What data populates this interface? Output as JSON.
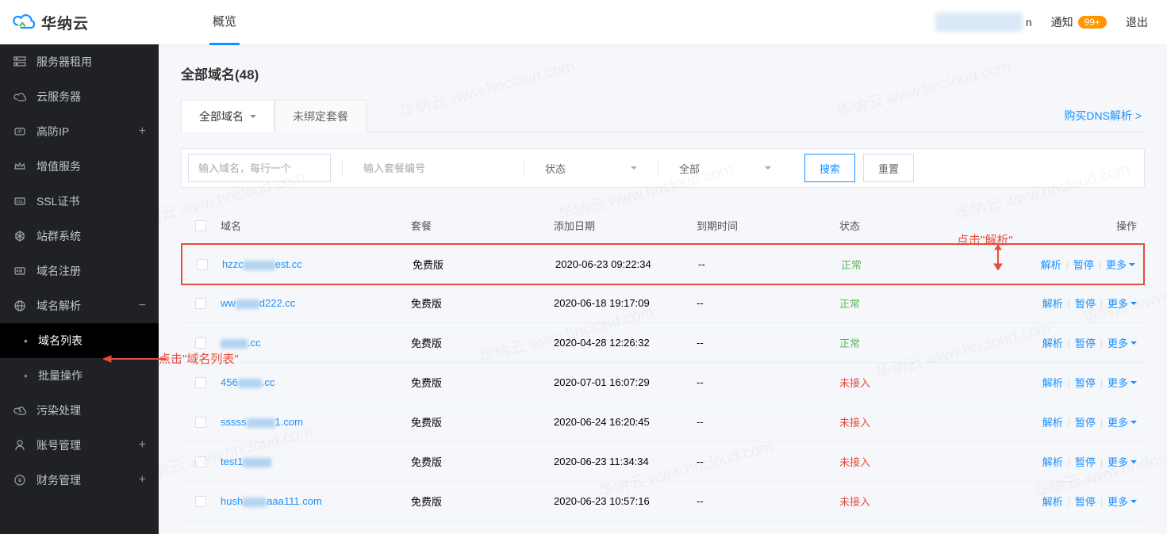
{
  "brand": "华纳云",
  "topnav": {
    "overview": "概览"
  },
  "user": {
    "suffix": "n"
  },
  "notification": {
    "label": "通知",
    "badge": "99+"
  },
  "logout": "退出",
  "sidebar": {
    "items": [
      {
        "label": "服务器租用",
        "icon": "server",
        "toggle": ""
      },
      {
        "label": "云服务器",
        "icon": "cloud",
        "toggle": ""
      },
      {
        "label": "高防IP",
        "icon": "shield-ip",
        "toggle": "+"
      },
      {
        "label": "增值服务",
        "icon": "crown",
        "toggle": ""
      },
      {
        "label": "SSL证书",
        "icon": "ssl",
        "toggle": ""
      },
      {
        "label": "站群系统",
        "icon": "cluster",
        "toggle": ""
      },
      {
        "label": "域名注册",
        "icon": "domain-reg",
        "toggle": ""
      },
      {
        "label": "域名解析",
        "icon": "globe",
        "toggle": "−"
      },
      {
        "label": "污染处理",
        "icon": "cloud-x",
        "toggle": ""
      },
      {
        "label": "账号管理",
        "icon": "user",
        "toggle": "+"
      },
      {
        "label": "财务管理",
        "icon": "wallet",
        "toggle": "+"
      }
    ],
    "sub": {
      "list": "域名列表",
      "batch": "批量操作"
    }
  },
  "page_title": "全部域名(48)",
  "tabs": {
    "all": "全部域名",
    "unbound": "未绑定套餐"
  },
  "buy_dns_link": "购买DNS解析 >",
  "filters": {
    "domain_placeholder": "输入域名，每行一个",
    "plan_placeholder": "输入套餐编号",
    "status_label": "状态",
    "scope_label": "全部",
    "search": "搜索",
    "reset": "重置"
  },
  "columns": {
    "domain": "域名",
    "plan": "套餐",
    "add_date": "添加日期",
    "expire": "到期时间",
    "status": "状态",
    "actions": "操作"
  },
  "status_text": {
    "ok": "正常",
    "bad": "未接入"
  },
  "action_labels": {
    "resolve": "解析",
    "pause": "暂停",
    "more": "更多"
  },
  "rows": [
    {
      "domain_pre": "hzzc",
      "domain_suf": "est.cc",
      "blur_w": 40,
      "plan": "免费版",
      "date": "2020-06-23 09:22:34",
      "expire": "--",
      "status": "ok"
    },
    {
      "domain_pre": "ww",
      "domain_suf": "d222.cc",
      "blur_w": 30,
      "plan": "免费版",
      "date": "2020-06-18 19:17:09",
      "expire": "--",
      "status": "ok"
    },
    {
      "domain_pre": "",
      "domain_suf": ".cc",
      "blur_w": 34,
      "plan": "免费版",
      "date": "2020-04-28 12:26:32",
      "expire": "--",
      "status": "ok"
    },
    {
      "domain_pre": "456",
      "domain_suf": ".cc",
      "blur_w": 30,
      "plan": "免费版",
      "date": "2020-07-01 16:07:29",
      "expire": "--",
      "status": "bad"
    },
    {
      "domain_pre": "sssss",
      "domain_suf": "1.com",
      "blur_w": 36,
      "plan": "免费版",
      "date": "2020-06-24 16:20:45",
      "expire": "--",
      "status": "bad"
    },
    {
      "domain_pre": "test1",
      "domain_suf": "",
      "blur_w": 36,
      "plan": "免费版",
      "date": "2020-06-23 11:34:34",
      "expire": "--",
      "status": "bad"
    },
    {
      "domain_pre": "hush",
      "domain_suf": "aaa111.com",
      "blur_w": 30,
      "plan": "免费版",
      "date": "2020-06-23 10:57:16",
      "expire": "--",
      "status": "bad"
    }
  ],
  "annotations": {
    "sidebar_hint": "点击\"域名列表\"",
    "action_hint": "点击\"解析\""
  },
  "watermark_text": "华纳云 www.hncloud.com"
}
